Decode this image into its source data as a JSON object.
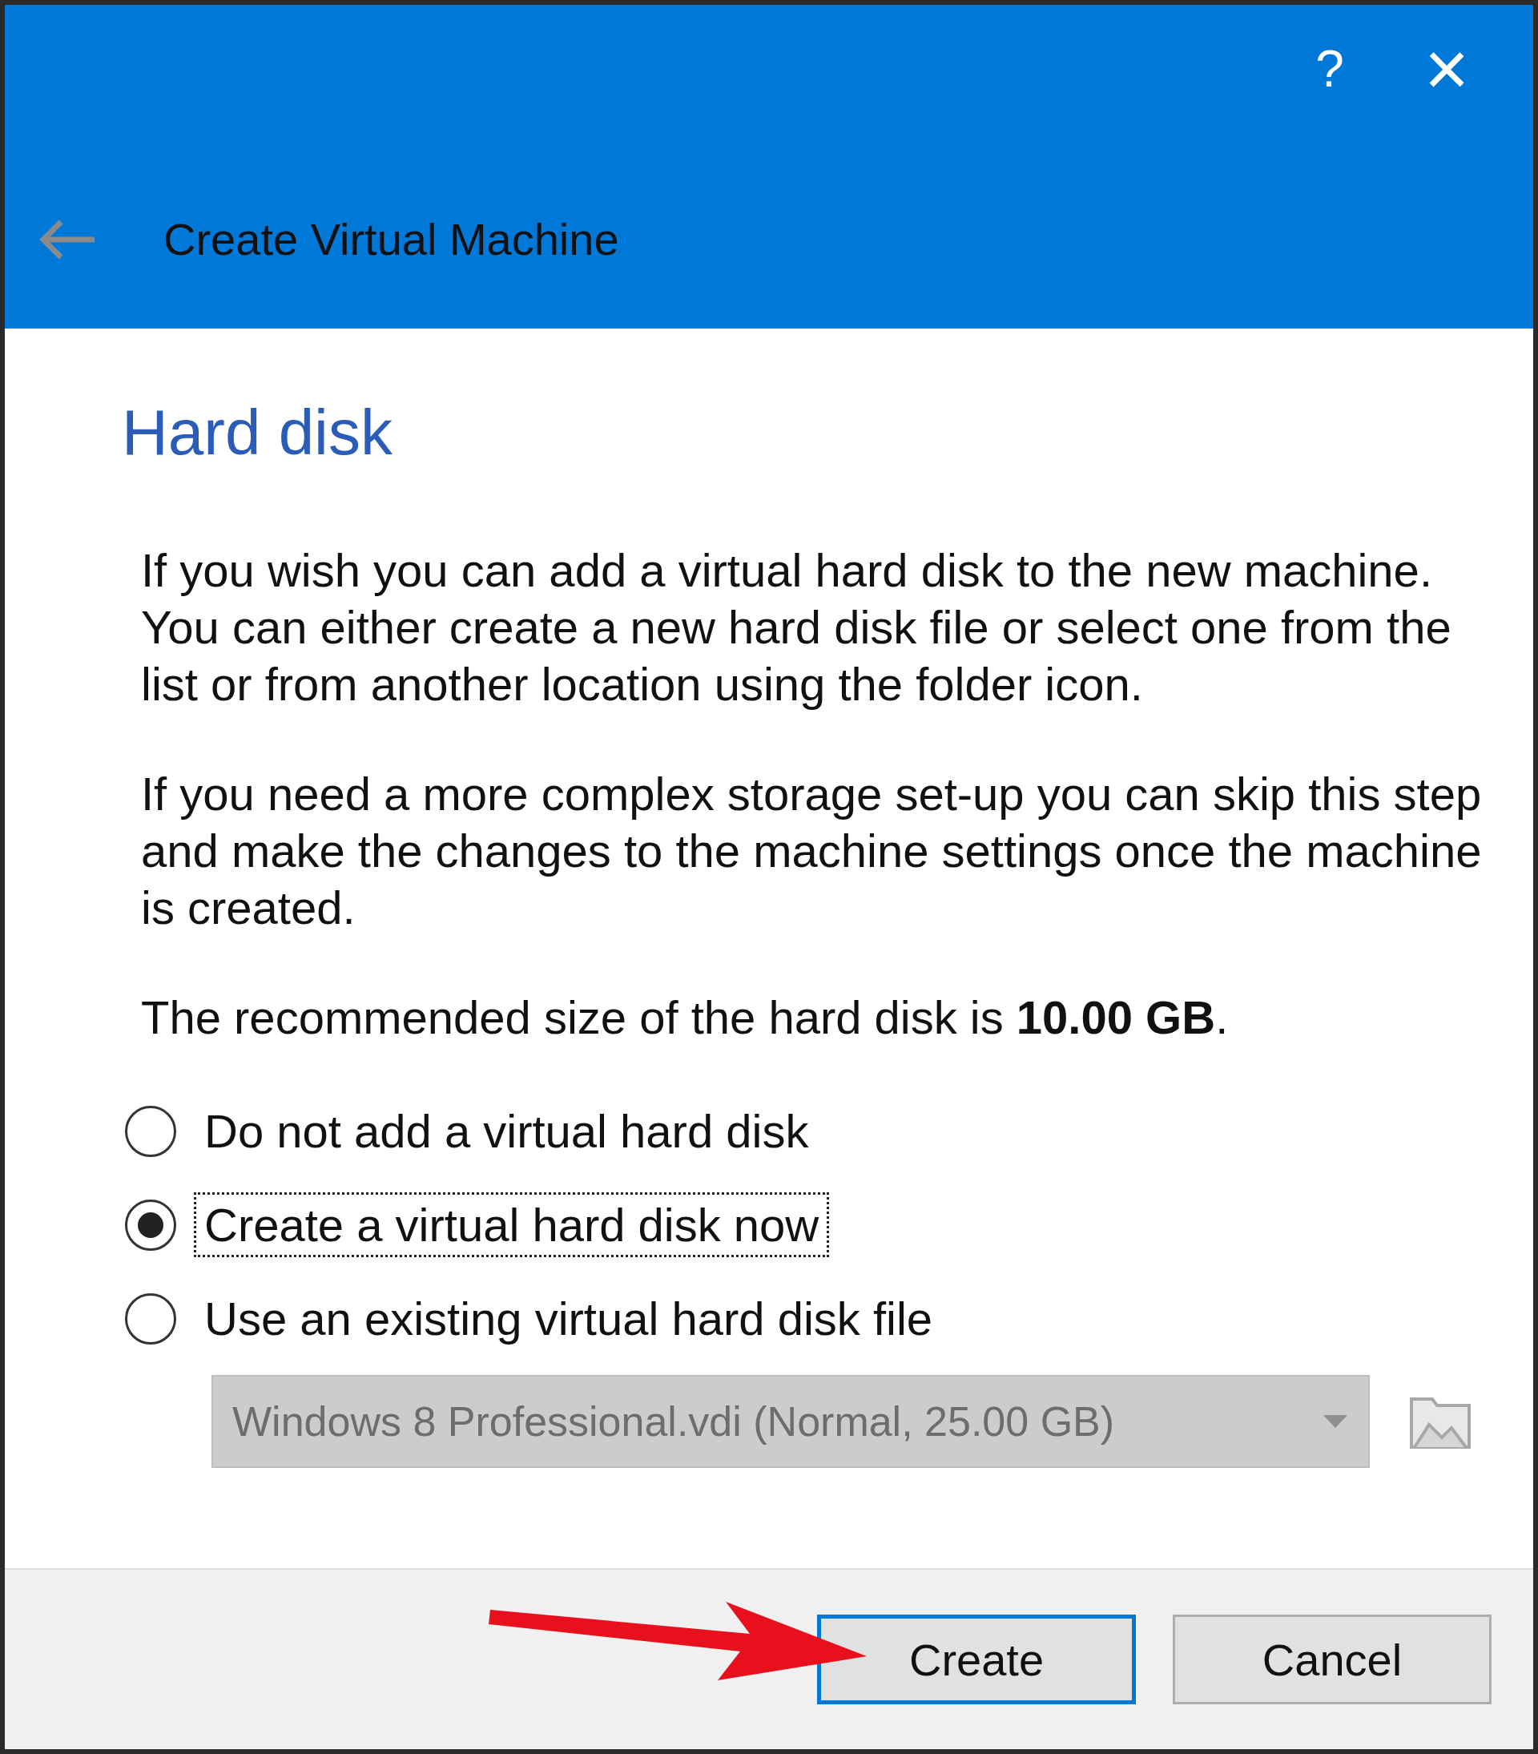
{
  "window": {
    "title": "Create Virtual Machine",
    "help": "?",
    "close": "×"
  },
  "page": {
    "heading": "Hard disk",
    "paragraphs": [
      "If you wish you can add a virtual hard disk to the new machine. You can either create a new hard disk file or select one from the list or from another location using the folder icon.",
      "If you need a more complex storage set-up you can skip this step and make the changes to the machine settings once the machine is created.",
      "The recommended size of the hard disk is **10.00 GB**."
    ],
    "options": [
      {
        "label": "Do not add a virtual hard disk",
        "selected": false,
        "focused": false
      },
      {
        "label": "Create a virtual hard disk now",
        "selected": true,
        "focused": true
      },
      {
        "label": "Use an existing virtual hard disk file",
        "selected": false,
        "focused": false
      }
    ],
    "disk_select": {
      "value": "Windows 8 Professional.vdi (Normal, 25.00 GB)",
      "disabled": true
    }
  },
  "buttons": [
    {
      "label": "Create",
      "default": true
    },
    {
      "label": "Cancel",
      "default": false
    }
  ]
}
